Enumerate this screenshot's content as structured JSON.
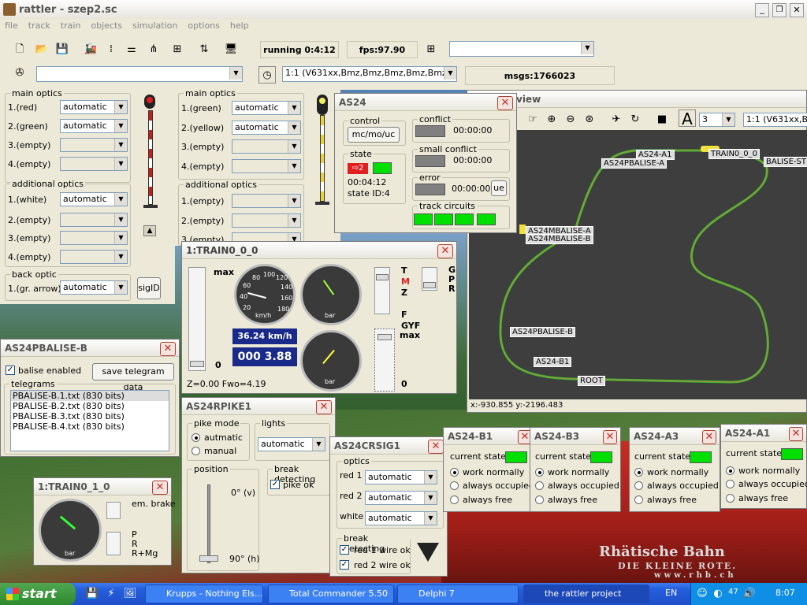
{
  "app": {
    "title": "rattler - szep2.sc",
    "menus": [
      "file",
      "track",
      "train",
      "objects",
      "simulation",
      "options",
      "help"
    ],
    "status": {
      "running": "running 0:4:12",
      "fps": "fps:97.90",
      "msgs": "msgs:1766023"
    },
    "train_select": "1:1 (V631xx,Bmz,Bmz,Bmz,Bmz,Bmz)"
  },
  "left_panel": {
    "main_optics_title": "main optics",
    "main_optics": [
      {
        "label": "1.(red)",
        "value": "automatic"
      },
      {
        "label": "2.(green)",
        "value": "automatic"
      },
      {
        "label": "3.(empty)",
        "value": ""
      },
      {
        "label": "4.(empty)",
        "value": ""
      }
    ],
    "additional_title": "additional optics",
    "additional": [
      {
        "label": "1.(white)",
        "value": "automatic"
      },
      {
        "label": "2.(empty)",
        "value": ""
      },
      {
        "label": "3.(empty)",
        "value": ""
      },
      {
        "label": "4.(empty)",
        "value": ""
      }
    ],
    "back_title": "back optic",
    "back": {
      "label": "1.(gr. arrow)",
      "value": "automatic"
    },
    "sigid": "sigID"
  },
  "mid_panel": {
    "main_optics_title": "main optics",
    "main_optics": [
      {
        "label": "1.(green)",
        "value": "automatic"
      },
      {
        "label": "2.(yellow)",
        "value": "automatic"
      },
      {
        "label": "3.(empty)",
        "value": ""
      },
      {
        "label": "4.(empty)",
        "value": ""
      }
    ],
    "additional_title": "additional optics",
    "additional": [
      {
        "label": "1.(empty)",
        "value": ""
      },
      {
        "label": "2.(empty)",
        "value": ""
      },
      {
        "label": "3.(empty)",
        "value": ""
      }
    ]
  },
  "as24": {
    "title": "AS24",
    "control_title": "control",
    "control_btn": "mc/mo/uc",
    "state_title": "state",
    "state_arrow": "2",
    "state_time": "00:04:12",
    "state_id": "state ID:4",
    "conflict_title": "conflict",
    "conflict_time": "00:00:00",
    "small_conflict_title": "small conflict",
    "small_conflict_time": "00:00:00",
    "error_title": "error",
    "error_time": "00:00:00",
    "error_btn": "ue",
    "track_title": "track circuits"
  },
  "view": {
    "title": "view",
    "zoom": "3",
    "train": "1:1 (V631xx,Bmz",
    "coords": "x:-930.855 y:-2196.483",
    "labels": [
      "AS24-A1",
      "AS24PBALISE-A",
      "TRAIN0_0_0",
      "BALISE-ST",
      "AS24MBALISE-A",
      "AS24MBALISE-B",
      "AS24PBALISE-B",
      "AS24-B1",
      "ROOT"
    ]
  },
  "train0": {
    "title": "1:TRAIN0_0_0",
    "max": "max",
    "zero": "0",
    "speed": "36.24 km/h",
    "dist": "000 3.88",
    "footer": "Z=0.00 Fwo=4.19",
    "brake_labels": [
      "T",
      "M",
      "Z",
      "F",
      "GYF"
    ],
    "right_labels": [
      "G",
      "P",
      "R"
    ],
    "max2": "max",
    "zero2": "0",
    "kmh": "km/h",
    "bar": "bar",
    "speed_ticks": [
      "20",
      "40",
      "60",
      "80",
      "100",
      "120",
      "140",
      "160",
      "180"
    ],
    "press_ticks": [
      "0",
      "1",
      "2",
      "3",
      "4",
      "5",
      "6",
      "7",
      "8",
      "9",
      "10"
    ]
  },
  "pbalise": {
    "title": "AS24PBALISE-B",
    "enabled": "balise enabled",
    "save_btn": "save telegram data",
    "telegrams_title": "telegrams",
    "telegrams": [
      "PBALISE-B.1.txt (830 bits)",
      "PBALISE-B.2.txt (830 bits)",
      "PBALISE-B.3.txt (830 bits)",
      "PBALISE-B.4.txt (830 bits)"
    ]
  },
  "train1": {
    "title": "1:TRAIN0_1_0",
    "em_brake": "em. brake",
    "labels": [
      "P",
      "R",
      "R+Mg"
    ],
    "bar": "bar"
  },
  "rpike": {
    "title": "AS24RPIKE1",
    "mode_title": "pike mode",
    "auto": "autmatic",
    "manual": "manual",
    "lights_title": "lights",
    "lights_value": "automatic",
    "position_title": "position",
    "pos_top": "0° (v)",
    "pos_bottom": "90° (h)",
    "break_title": "break detecting",
    "pike_ok": "pike ok"
  },
  "crsig": {
    "title": "AS24CRSIG1",
    "optics_title": "optics",
    "rows": [
      {
        "label": "red 1",
        "value": "automatic"
      },
      {
        "label": "red 2",
        "value": "automatic"
      },
      {
        "label": "white",
        "value": "automatic"
      }
    ],
    "break_title": "break detecting",
    "red1": "red 1 wire ok",
    "red2": "red 2 wire ok"
  },
  "section_windows": [
    {
      "title": "AS24-B1"
    },
    {
      "title": "AS24-B3"
    },
    {
      "title": "AS24-A3"
    },
    {
      "title": "AS24-A1"
    }
  ],
  "section_text": {
    "current": "current state:",
    "opts": [
      "work normally",
      "always occupied",
      "always free"
    ]
  },
  "desktop": {
    "rhb1": "Rhätische Bahn",
    "rhb2": "DIE KLEINE ROTE.",
    "rhb3": "www.rhb.ch"
  },
  "taskbar": {
    "start": "start",
    "tasks": [
      "Krupps - Nothing Els...",
      "Total Commander 5.50",
      "Delphi 7",
      "the rattler project"
    ],
    "lang": "EN",
    "time": "8:07",
    "tray_num": "47"
  },
  "colors": {
    "led_green": "#00e000",
    "led_off": "#808080",
    "track": "#30c030",
    "alarm": "#e02020"
  }
}
